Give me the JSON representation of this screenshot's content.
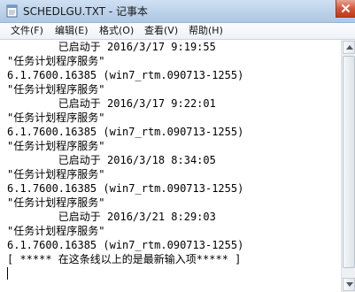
{
  "window": {
    "title": "SCHEDLGU.TXT - 记事本",
    "icon": "notepad-icon",
    "close_icon": "close-icon"
  },
  "menu": {
    "items": [
      {
        "label": "文件(F)"
      },
      {
        "label": "编辑(E)"
      },
      {
        "label": "格式(O)"
      },
      {
        "label": "查看(V)"
      },
      {
        "label": "帮助(H)"
      }
    ]
  },
  "content": {
    "lines": [
      "        已启动于 2016/3/17 9:19:55",
      "\"任务计划程序服务\"",
      "6.1.7600.16385 (win7_rtm.090713-1255)",
      "\"任务计划程序服务\"",
      "        已启动于 2016/3/17 9:22:01",
      "\"任务计划程序服务\"",
      "6.1.7600.16385 (win7_rtm.090713-1255)",
      "\"任务计划程序服务\"",
      "        已启动于 2016/3/18 8:34:05",
      "\"任务计划程序服务\"",
      "6.1.7600.16385 (win7_rtm.090713-1255)",
      "\"任务计划程序服务\"",
      "        已启动于 2016/3/21 8:29:03",
      "\"任务计划程序服务\"",
      "6.1.7600.16385 (win7_rtm.090713-1255)",
      "[ ***** 在这条线以上的是最新输入项***** ]"
    ]
  },
  "colors": {
    "titlebar": "#bcd2ea",
    "close_button": "#c2391b",
    "text": "#000000"
  }
}
